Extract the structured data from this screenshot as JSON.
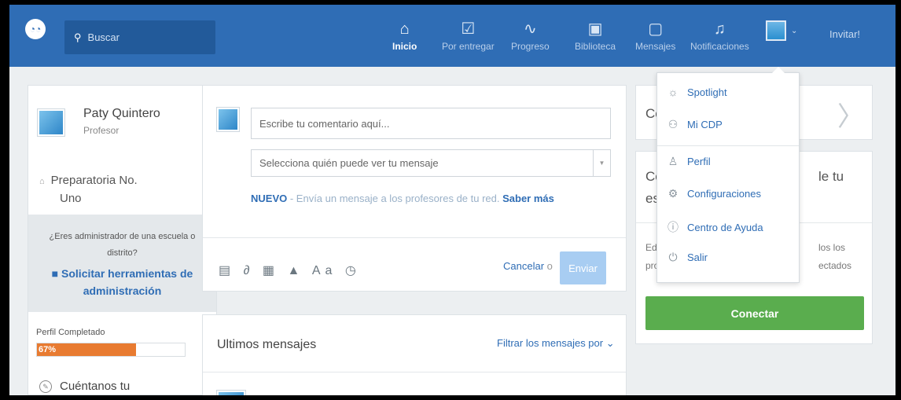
{
  "topbar": {
    "search_placeholder": "Buscar",
    "nav": [
      {
        "label": "Inicio",
        "icon": "home-icon",
        "glyph": "⌂"
      },
      {
        "label": "Por entregar",
        "icon": "assignment-icon",
        "glyph": "☑"
      },
      {
        "label": "Progreso",
        "icon": "progress-icon",
        "glyph": "∿"
      },
      {
        "label": "Biblioteca",
        "icon": "library-icon",
        "glyph": "▣"
      },
      {
        "label": "Mensajes",
        "icon": "message-icon",
        "glyph": "▢"
      },
      {
        "label": "Notificaciones",
        "icon": "bell-icon",
        "glyph": "♫"
      }
    ],
    "invite_label": "Invitar!"
  },
  "profile": {
    "name": "Paty Quintero",
    "role": "Profesor",
    "school_line1": "Preparatoria No.",
    "school_line2": "Uno",
    "admin_question_1": "¿Eres administrador de una escuela o",
    "admin_question_2": "distrito?",
    "admin_link_1": "Solicitar herramientas de",
    "admin_link_2": "administración",
    "progress_label": "Perfil Completado",
    "progress_text": "67%",
    "progress_value": 67,
    "tell_us": "Cuéntanos tu"
  },
  "composer": {
    "comment_placeholder": "Escribe tu comentario aquí...",
    "audience_placeholder": "Selecciona quién puede ver tu mensaje",
    "nuevo_label": "NUEVO",
    "nuevo_text": " - Envía un mensaje a los profesores de tu red. ",
    "more_link": "Saber más",
    "tool_icons": "▤ ∂ ▦ ▲ Aa ◷",
    "cancel_label": "Cancelar",
    "or_label": "o",
    "send_label": "Enviar"
  },
  "feed": {
    "title": "Ultimos mensajes",
    "filter_label": "Filtrar los mensajes por ⌄"
  },
  "right": {
    "card1_title": "Co",
    "card2_title_a": "Co",
    "card2_title_b": "le tu",
    "card2_title_c": "es",
    "card2_body_a": "Ed",
    "card2_body_b": "los los",
    "card2_body_c": "pro",
    "card2_body_d": "ectados",
    "connect_label": "Conectar"
  },
  "dropdown": {
    "items": [
      {
        "label": "Spotlight",
        "glyph": "☼"
      },
      {
        "label": "Mi CDP",
        "glyph": "⚇"
      },
      {
        "label": "Perfil",
        "glyph": "♙"
      },
      {
        "label": "Configuraciones",
        "glyph": "⚙"
      },
      {
        "label": "Centro de Ayuda",
        "glyph": "ⓘ"
      },
      {
        "label": "Salir",
        "glyph": "⏻"
      }
    ]
  },
  "colors": {
    "brand": "#2f6db5",
    "progress": "#e87b31",
    "connect": "#5aad4e"
  }
}
